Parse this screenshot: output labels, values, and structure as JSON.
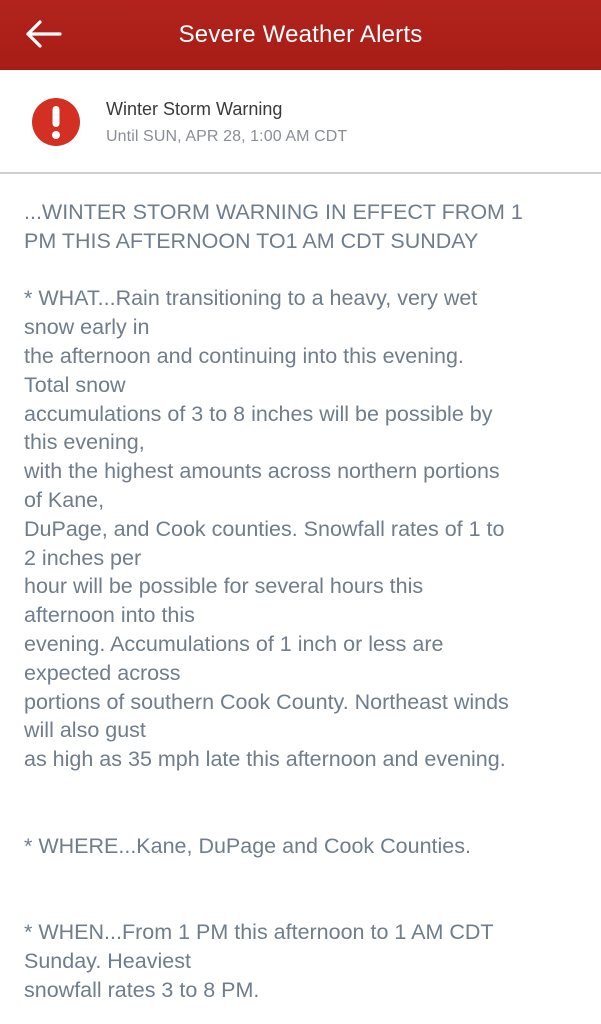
{
  "header": {
    "title": "Severe Weather Alerts",
    "back_icon": "arrow-left-icon"
  },
  "alert": {
    "icon": "exclamation-circle-icon",
    "icon_color": "#d32f23",
    "title": "Winter Storm Warning",
    "until": "Until SUN, APR 28, 1:00 AM CDT"
  },
  "body": {
    "headline": [
      "...WINTER STORM WARNING IN EFFECT FROM 1",
      "PM THIS AFTERNOON TO1 AM CDT SUNDAY"
    ],
    "what": [
      "* WHAT...Rain transitioning to a heavy, very wet",
      "snow early in",
      "the afternoon and continuing into this evening.",
      "Total snow",
      "accumulations of 3 to 8 inches will be possible by",
      "this evening,",
      "with the highest amounts across northern portions",
      "of Kane,",
      "DuPage, and Cook counties. Snowfall rates of 1 to",
      "2 inches per",
      "hour will be possible for several hours this",
      "afternoon into this",
      "evening. Accumulations of 1 inch or less are",
      "expected across",
      "portions of southern Cook County. Northeast winds",
      "will also gust",
      "as high as 35 mph late this afternoon and evening."
    ],
    "where": [
      "* WHERE...Kane, DuPage and Cook Counties."
    ],
    "when": [
      "* WHEN...From 1 PM this afternoon to 1 AM CDT",
      "Sunday. Heaviest",
      "snowfall rates 3 to 8 PM."
    ]
  },
  "colors": {
    "header_bg": "#b2231d",
    "body_text": "#6f7d8c",
    "divider": "#cfcfd2"
  }
}
